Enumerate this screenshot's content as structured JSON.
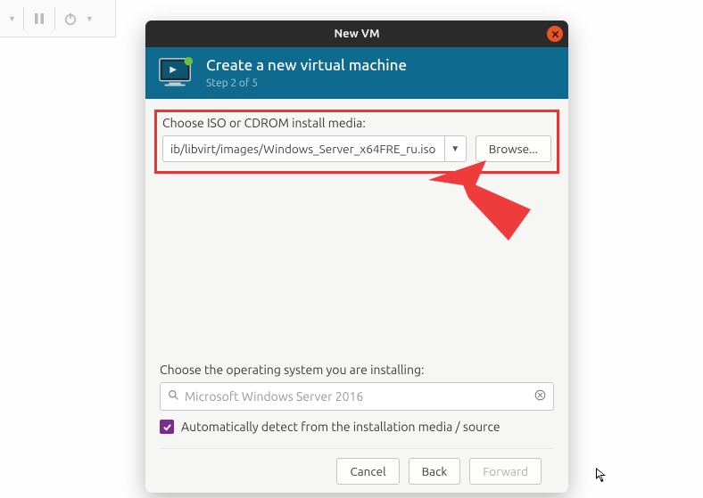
{
  "host_toolbar": {
    "pause_icon": "pause-icon",
    "power_icon": "power-icon"
  },
  "window": {
    "title": "New VM"
  },
  "header": {
    "title": "Create a new virtual machine",
    "step": "Step 2 of 5"
  },
  "media": {
    "label": "Choose ISO or CDROM install media:",
    "path": "ib/libvirt/images/Windows_Server_x64FRE_ru.iso",
    "browse_label": "Browse..."
  },
  "os": {
    "label": "Choose the operating system you are installing:",
    "value": "Microsoft Windows Server 2016",
    "autodetect_label": "Automatically detect from the installation media / source",
    "autodetect_checked": true
  },
  "buttons": {
    "cancel": "Cancel",
    "back": "Back",
    "forward": "Forward"
  }
}
